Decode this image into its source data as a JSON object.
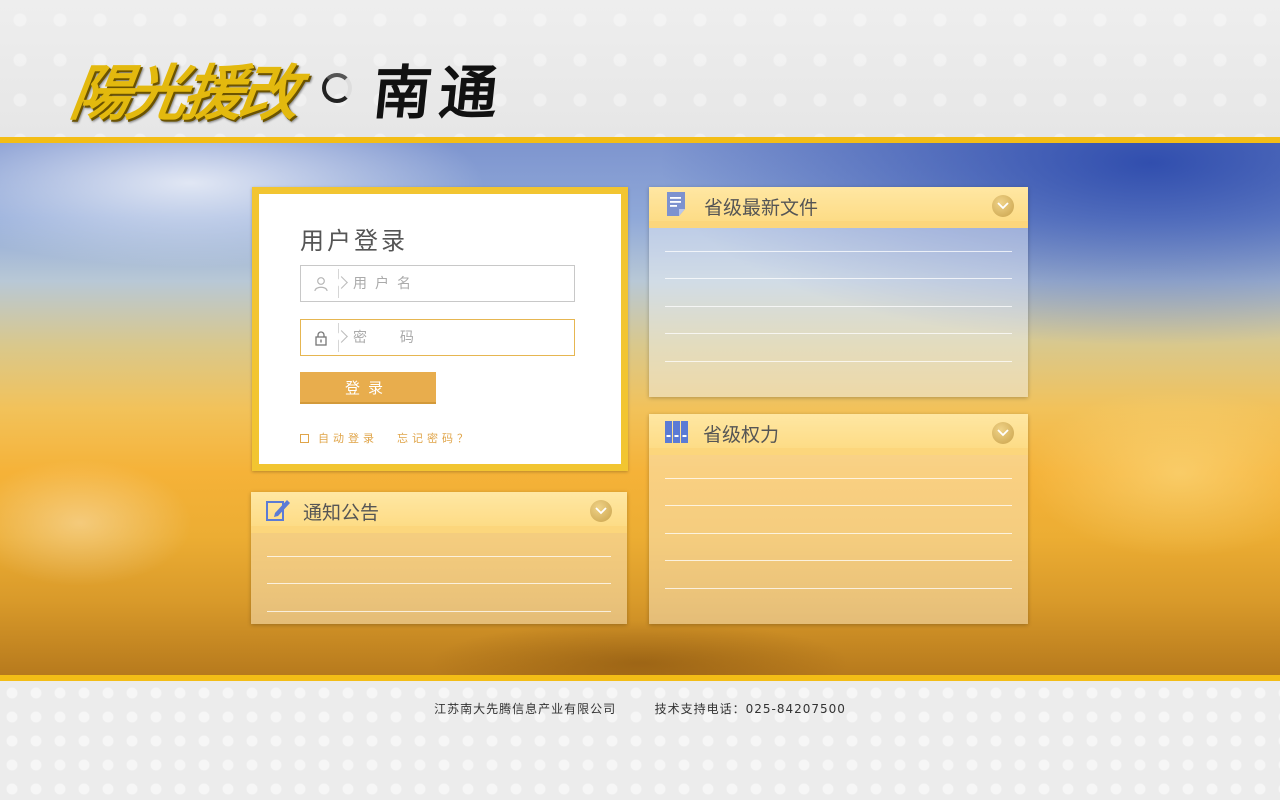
{
  "header": {
    "logo_brand": "陽光援改",
    "logo_city": "南通"
  },
  "login": {
    "title": "用户登录",
    "username_placeholder": "用户名",
    "password_placeholder": "密  码",
    "submit_label": "登录",
    "remember_label": "自动登录",
    "forgot_label": "忘记密码？",
    "remember_checked": false
  },
  "panels": {
    "notice": {
      "title": "通知公告",
      "icon": "edit-note-icon"
    },
    "files": {
      "title": "省级最新文件",
      "icon": "document-icon"
    },
    "power": {
      "title": "省级权力",
      "icon": "books-icon"
    }
  },
  "footer": {
    "company": "江苏南大先腾信息产业有限公司",
    "support": "技术支持电话：025-84207500"
  },
  "colors": {
    "accent_gold": "#f3bd16",
    "button": "#e8ad4d",
    "panel_header": "#ffe3a0",
    "link": "#e0a54a"
  }
}
